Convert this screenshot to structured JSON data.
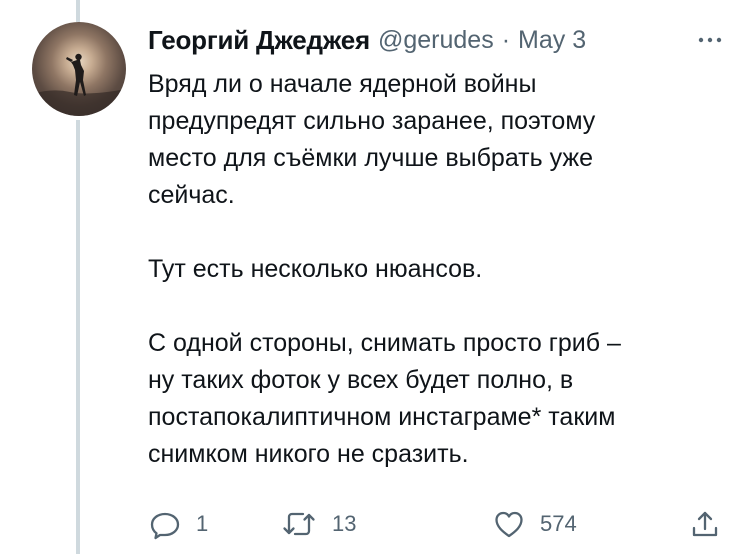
{
  "author": {
    "display_name": "Георгий Джеджея",
    "handle": "@gerudes",
    "separator": "·",
    "date": "May 3",
    "avatar_icon": "person-silhouette-avatar"
  },
  "tweet": {
    "text": "Вряд ли о начале ядерной войны\nпредупредят сильно заранее, поэтому\nместо для съёмки лучше выбрать уже\nсейчас.\n\nТут есть несколько нюансов.\n\nС одной стороны, снимать просто гриб –\nну таких фоток у всех будет полно, в\nпостапокалиптичном инстаграме* таким\nснимком никого не сразить."
  },
  "actions": {
    "reply": {
      "icon": "reply-icon",
      "count": "1"
    },
    "retweet": {
      "icon": "retweet-icon",
      "count": "13"
    },
    "like": {
      "icon": "heart-icon",
      "count": "574"
    },
    "share": {
      "icon": "share-icon"
    }
  },
  "more": {
    "icon": "more-icon"
  },
  "colors": {
    "primary_text": "#0f1419",
    "secondary_text": "#536471",
    "thread_line": "#cfd9de",
    "background": "#ffffff"
  }
}
